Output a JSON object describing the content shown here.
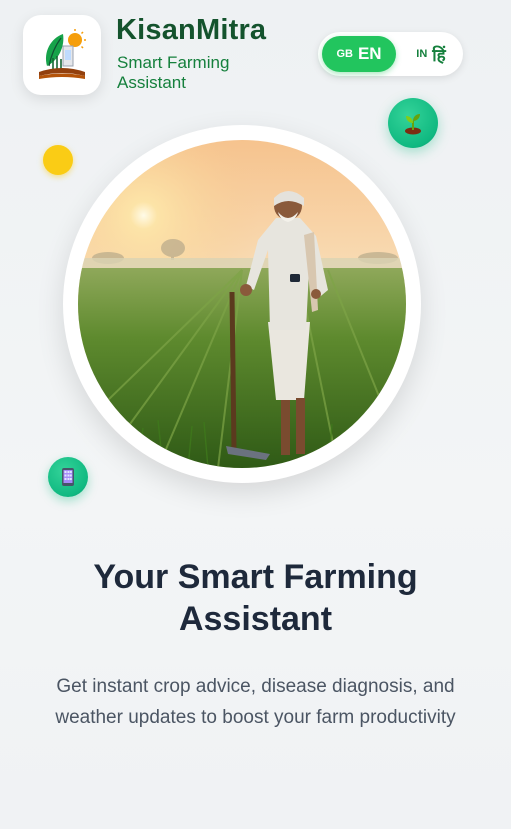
{
  "brand": {
    "title": "KisanMitra",
    "subtitle": "Smart Farming Assistant",
    "logo_icon": "farm-logo-icon"
  },
  "language_toggle": {
    "english": {
      "flag": "GB",
      "label": "EN",
      "selected": true
    },
    "hindi": {
      "flag": "IN",
      "label": "हिं",
      "selected": false
    }
  },
  "floating_icons": {
    "sprout": "sprout-icon",
    "phone": "phone-icon"
  },
  "hero": {
    "image": "farmer-in-field-photo"
  },
  "content": {
    "headline": "Your Smart Farming Assistant",
    "description": "Get instant crop advice, disease diagnosis, and weather updates to boost your farm productivity"
  },
  "colors": {
    "primary_green": "#22c55e",
    "brand_dark_green": "#14532d",
    "accent_yellow": "#facc15",
    "heading": "#1e293b",
    "body_text": "#4b5563"
  }
}
